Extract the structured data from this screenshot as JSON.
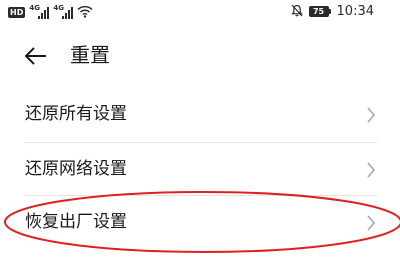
{
  "status_bar": {
    "hd_label": "HD",
    "sim1_network": "4G",
    "sim2_network": "4G",
    "battery_level": "75",
    "time": "10:34",
    "icons": [
      "signal-icon",
      "wifi-icon",
      "mute-bell-icon",
      "battery-icon"
    ]
  },
  "header": {
    "title": "重置",
    "back_icon": "arrow-left-icon"
  },
  "list": {
    "items": [
      {
        "label": "还原所有设置"
      },
      {
        "label": "还原网络设置"
      },
      {
        "label": "恢复出厂设置",
        "highlighted": true
      }
    ]
  },
  "colors": {
    "highlight_ellipse": "#e02020",
    "divider": "#e3e3e3",
    "chevron": "#a8a8a8",
    "text": "#1a1a1a"
  }
}
